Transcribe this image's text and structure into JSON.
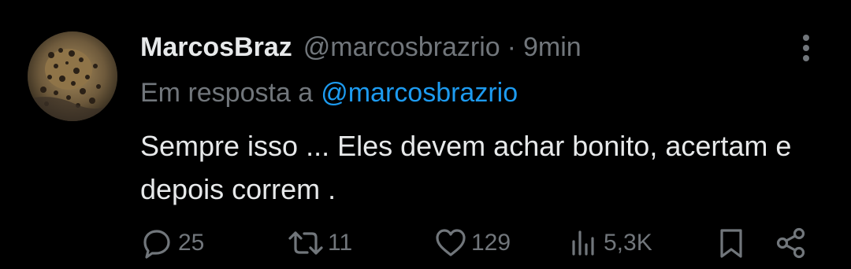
{
  "tweet": {
    "display_name": "MarcosBraz",
    "handle": "@marcosbrazrio",
    "separator": "·",
    "time": "9min",
    "reply_prefix": "Em resposta a",
    "reply_to": "@marcosbrazrio",
    "text": "Sempre isso ... Eles devem achar bonito, acertam e depois correm ."
  },
  "actions": {
    "replies": "25",
    "retweets": "11",
    "likes": "129",
    "views": "5,3K"
  },
  "icons": {
    "reply": "reply-icon",
    "retweet": "retweet-icon",
    "like": "heart-icon",
    "views": "views-icon",
    "bookmark": "bookmark-icon",
    "share": "share-icon",
    "more": "more-vertical-icon"
  },
  "colors": {
    "background": "#000000",
    "primary_text": "#e7e9ea",
    "secondary_text": "#71767b",
    "link": "#1d9bf0"
  }
}
